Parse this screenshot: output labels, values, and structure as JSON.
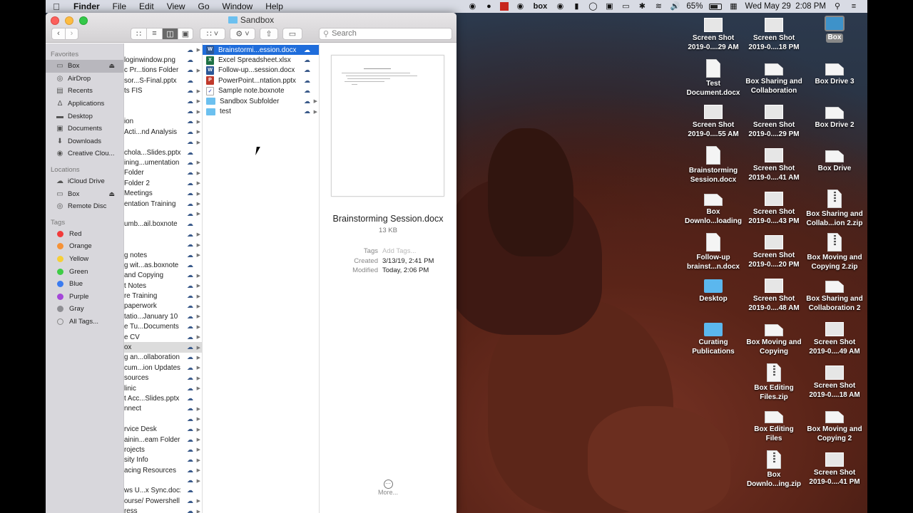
{
  "menubar": {
    "app_name": "Finder",
    "menus": [
      "File",
      "Edit",
      "View",
      "Go",
      "Window",
      "Help"
    ],
    "battery": "65%",
    "datetime": "Wed May 29  2:08 PM",
    "status_icons": [
      "creative-cloud-icon",
      "app-icon",
      "red-square-icon",
      "app-icon",
      "box-icon",
      "app-icon",
      "app-icon",
      "sync-icon",
      "screen-record-icon",
      "airplay-icon",
      "bluetooth-icon",
      "wifi-icon",
      "volume-icon",
      "battery-icon",
      "app-icon",
      "spotlight-icon",
      "notification-center-icon"
    ],
    "box_label": "box"
  },
  "window": {
    "title": "Sandbox",
    "search_placeholder": "Search"
  },
  "sidebar": {
    "favorites_header": "Favorites",
    "favorites": [
      {
        "label": "Box",
        "icon": "folder-icon",
        "selected": true,
        "eject": true
      },
      {
        "label": "AirDrop",
        "icon": "airdrop-icon"
      },
      {
        "label": "Recents",
        "icon": "recents-icon"
      },
      {
        "label": "Applications",
        "icon": "applications-icon"
      },
      {
        "label": "Desktop",
        "icon": "desktop-icon"
      },
      {
        "label": "Documents",
        "icon": "documents-icon"
      },
      {
        "label": "Downloads",
        "icon": "downloads-icon"
      },
      {
        "label": "Creative Clou...",
        "icon": "creative-cloud-icon"
      }
    ],
    "locations_header": "Locations",
    "locations": [
      {
        "label": "iCloud Drive",
        "icon": "cloud-icon"
      },
      {
        "label": "Box",
        "icon": "folder-icon",
        "eject": true
      },
      {
        "label": "Remote Disc",
        "icon": "disc-icon"
      }
    ],
    "tags_header": "Tags",
    "tags": [
      {
        "label": "Red",
        "color": "#f23b3b"
      },
      {
        "label": "Orange",
        "color": "#f69236"
      },
      {
        "label": "Yellow",
        "color": "#f6cf38"
      },
      {
        "label": "Green",
        "color": "#3fcc46"
      },
      {
        "label": "Blue",
        "color": "#3b7bf0"
      },
      {
        "label": "Purple",
        "color": "#a447d8"
      },
      {
        "label": "Gray",
        "color": "#8e8e93"
      },
      {
        "label": "All Tags...",
        "color": "#d0d0d0"
      }
    ]
  },
  "column1": [
    {
      "name": "",
      "folder": true
    },
    {
      "name": "loginwindow.png",
      "folder": false
    },
    {
      "name": "c Pr...tions Folder",
      "folder": true
    },
    {
      "name": "sor...S-Final.pptx",
      "folder": false
    },
    {
      "name": "ts FIS",
      "folder": true
    },
    {
      "name": "",
      "folder": true
    },
    {
      "name": "",
      "folder": true
    },
    {
      "name": "ion",
      "folder": true
    },
    {
      "name": " Acti...nd Analysis",
      "folder": true
    },
    {
      "name": "",
      "folder": true
    },
    {
      "name": "chola...Slides.pptx",
      "folder": false
    },
    {
      "name": "ining...umentation",
      "folder": true
    },
    {
      "name": "Folder",
      "folder": true
    },
    {
      "name": "Folder 2",
      "folder": true
    },
    {
      "name": "Meetings",
      "folder": true
    },
    {
      "name": "entation Training",
      "folder": true
    },
    {
      "name": "",
      "folder": true
    },
    {
      "name": "umb...ail.boxnote",
      "folder": false
    },
    {
      "name": "",
      "folder": true
    },
    {
      "name": "",
      "folder": true
    },
    {
      "name": "g notes",
      "folder": true
    },
    {
      "name": "g wit...as.boxnote",
      "folder": false
    },
    {
      "name": " and Copying",
      "folder": true
    },
    {
      "name": "t Notes",
      "folder": true
    },
    {
      "name": "re Training",
      "folder": true
    },
    {
      "name": "paperwork",
      "folder": true
    },
    {
      "name": "tatio...January 10",
      "folder": true
    },
    {
      "name": "e Tu...Documents",
      "folder": true
    },
    {
      "name": "e CV",
      "folder": true
    },
    {
      "name": "ox",
      "folder": true,
      "selected": true
    },
    {
      "name": "g an...ollaboration",
      "folder": true
    },
    {
      "name": "cum...ion Updates",
      "folder": true
    },
    {
      "name": "sources",
      "folder": true
    },
    {
      "name": "linic",
      "folder": true
    },
    {
      "name": "t Acc...Slides.pptx",
      "folder": false
    },
    {
      "name": "nnect",
      "folder": true
    },
    {
      "name": "",
      "folder": true
    },
    {
      "name": "rvice Desk",
      "folder": true
    },
    {
      "name": "ainin...eam Folder",
      "folder": true
    },
    {
      "name": "rojects",
      "folder": true
    },
    {
      "name": "sity Info",
      "folder": true
    },
    {
      "name": "acing Resources",
      "folder": true
    },
    {
      "name": "",
      "folder": true
    },
    {
      "name": "ws U...x Sync.docx",
      "folder": false
    },
    {
      "name": "ourse/ Powershell",
      "folder": true
    },
    {
      "name": "ress",
      "folder": true
    }
  ],
  "column2": [
    {
      "name": "Brainstormi...ession.docx",
      "type": "docx",
      "type_label": "W",
      "selected": true,
      "folder": false
    },
    {
      "name": "Excel Spreadsheet.xlsx",
      "type": "xlsx",
      "type_label": "X",
      "folder": false
    },
    {
      "name": "Follow-up...session.docx",
      "type": "docx",
      "type_label": "W",
      "folder": false
    },
    {
      "name": "PowerPoint...ntation.pptx",
      "type": "pptx",
      "type_label": "P",
      "folder": false
    },
    {
      "name": "Sample note.boxnote",
      "type": "note",
      "type_label": "✓",
      "folder": false
    },
    {
      "name": "Sandbox Subfolder",
      "type": "folder",
      "type_label": "",
      "folder": true
    },
    {
      "name": "test",
      "type": "folder",
      "type_label": "",
      "folder": true
    }
  ],
  "preview": {
    "file_name": "Brainstorming Session.docx",
    "size": "13 KB",
    "tags_label": "Tags",
    "tags_placeholder": "Add Tags...",
    "created_label": "Created",
    "created": "3/13/19, 2:41 PM",
    "modified_label": "Modified",
    "modified": "Today, 2:06 PM",
    "more_label": "More..."
  },
  "desktop_icons": [
    {
      "line1": "Screen Shot",
      "line2": "2019-0....29 AM",
      "kind": "shot"
    },
    {
      "line1": "Screen Shot",
      "line2": "2019-0....18 PM",
      "kind": "shot"
    },
    {
      "line1": "Box",
      "line2": "",
      "kind": "boxfolder",
      "selected": true
    },
    {
      "line1": "Test",
      "line2": "Document.docx",
      "kind": "doc"
    },
    {
      "line1": "Box Sharing and",
      "line2": "Collaboration",
      "kind": "wide"
    },
    {
      "line1": "Box Drive 3",
      "line2": "",
      "kind": "wide"
    },
    {
      "line1": "Screen Shot",
      "line2": "2019-0....55 AM",
      "kind": "shot"
    },
    {
      "line1": "Screen Shot",
      "line2": "2019-0....29 PM",
      "kind": "shot"
    },
    {
      "line1": "Box Drive 2",
      "line2": "",
      "kind": "wide"
    },
    {
      "line1": "Brainstorming",
      "line2": "Session.docx",
      "kind": "doc"
    },
    {
      "line1": "Screen Shot",
      "line2": "2019-0....41 AM",
      "kind": "shot"
    },
    {
      "line1": "Box Drive",
      "line2": "",
      "kind": "wide"
    },
    {
      "line1": "Box",
      "line2": "Downlo...loading",
      "kind": "wide"
    },
    {
      "line1": "Screen Shot",
      "line2": "2019-0....43 PM",
      "kind": "shot"
    },
    {
      "line1": "Box Sharing and",
      "line2": "Collab...ion 2.zip",
      "kind": "zip"
    },
    {
      "line1": "Follow-up",
      "line2": "brainst...n.docx",
      "kind": "doc"
    },
    {
      "line1": "Screen Shot",
      "line2": "2019-0....20 PM",
      "kind": "shot"
    },
    {
      "line1": "Box Moving and",
      "line2": "Copying 2.zip",
      "kind": "zip"
    },
    {
      "line1": "Desktop",
      "line2": "",
      "kind": "folder"
    },
    {
      "line1": "Screen Shot",
      "line2": "2019-0....48 AM",
      "kind": "shot"
    },
    {
      "line1": "Box Sharing and",
      "line2": "Collaboration 2",
      "kind": "wide"
    },
    {
      "line1": "Curating",
      "line2": "Publications",
      "kind": "folder"
    },
    {
      "line1": "Box Moving and",
      "line2": "Copying",
      "kind": "wide"
    },
    {
      "line1": "Screen Shot",
      "line2": "2019-0....49 AM",
      "kind": "shot"
    },
    {
      "line1": "",
      "line2": "",
      "kind": "none"
    },
    {
      "line1": "Box Editing",
      "line2": "Files.zip",
      "kind": "zip"
    },
    {
      "line1": "Screen Shot",
      "line2": "2019-0....18 AM",
      "kind": "shot"
    },
    {
      "line1": "",
      "line2": "",
      "kind": "none"
    },
    {
      "line1": "Box Editing",
      "line2": "Files",
      "kind": "wide"
    },
    {
      "line1": "Box Moving and",
      "line2": "Copying 2",
      "kind": "wide"
    },
    {
      "line1": "",
      "line2": "",
      "kind": "none"
    },
    {
      "line1": "Box",
      "line2": "Downlo...ing.zip",
      "kind": "zip"
    },
    {
      "line1": "Screen Shot",
      "line2": "2019-0....41 PM",
      "kind": "shot"
    }
  ]
}
